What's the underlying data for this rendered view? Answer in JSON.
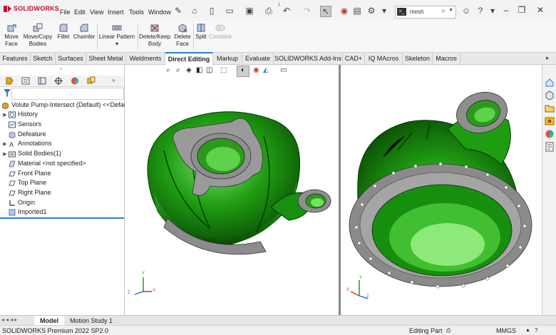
{
  "app": {
    "logo_text": "SOLIDWORKS",
    "menus": [
      "File",
      "Edit",
      "View",
      "Insert",
      "Tools",
      "Window"
    ],
    "search_value": "mesh",
    "brand_color": "#c8102e",
    "accent_color": "#2f7bd2",
    "model_color": "#1f9d12"
  },
  "commands": [
    {
      "label1": "Move",
      "label2": "Face",
      "icon": "move-face-icon",
      "enabled": true
    },
    {
      "label1": "Move/Copy",
      "label2": "Bodies",
      "icon": "move-copy-bodies-icon",
      "enabled": true
    },
    {
      "label1": "Fillet",
      "label2": "",
      "icon": "fillet-icon",
      "enabled": true
    },
    {
      "label1": "Chamfer",
      "label2": "",
      "icon": "chamfer-icon",
      "enabled": true
    },
    {
      "label1": "Linear Pattern",
      "label2": "",
      "icon": "linear-pattern-icon",
      "enabled": true
    },
    {
      "label1": "Delete/Keep",
      "label2": "Body",
      "icon": "delete-keep-body-icon",
      "enabled": true
    },
    {
      "label1": "Delete",
      "label2": "Face",
      "icon": "delete-face-icon",
      "enabled": true
    },
    {
      "label1": "Split",
      "label2": "",
      "icon": "split-icon",
      "enabled": true
    },
    {
      "label1": "Combine",
      "label2": "",
      "icon": "combine-icon",
      "enabled": false
    }
  ],
  "tabs": [
    "Features",
    "Sketch",
    "Surfaces",
    "Sheet Metal",
    "Weldments",
    "Direct Editing",
    "Markup",
    "Evaluate",
    "SOLIDWORKS Add-Ins",
    "CAD+",
    "IQ MAcros",
    "Skeleton",
    "Macros"
  ],
  "active_tab": "Direct Editing",
  "tree": {
    "root": "Volute Pump-Intersect (Default) <<Default",
    "items": [
      {
        "label": "History",
        "icon": "history-folder-icon",
        "expandable": true
      },
      {
        "label": "Sensors",
        "icon": "sensors-icon",
        "expandable": false
      },
      {
        "label": "Defeature",
        "icon": "defeature-icon",
        "expandable": false
      },
      {
        "label": "Annotations",
        "icon": "annotations-icon",
        "expandable": true
      },
      {
        "label": "Solid Bodies(1)",
        "icon": "solid-bodies-folder-icon",
        "expandable": true
      },
      {
        "label": "Material <not specified>",
        "icon": "material-icon",
        "expandable": false
      },
      {
        "label": "Front Plane",
        "icon": "plane-icon",
        "expandable": false
      },
      {
        "label": "Top Plane",
        "icon": "plane-icon",
        "expandable": false
      },
      {
        "label": "Right Plane",
        "icon": "plane-icon",
        "expandable": false
      },
      {
        "label": "Origin",
        "icon": "origin-icon",
        "expandable": false
      },
      {
        "label": "Imported1",
        "icon": "imported-body-icon",
        "expandable": false
      }
    ]
  },
  "triad": {
    "x": "X",
    "y": "Y",
    "z": "Z"
  },
  "bottom_tabs": [
    "Model",
    "Motion Study 1"
  ],
  "status": {
    "left": "SOLIDWORKS Premium 2022 SP2.0",
    "mode": "Editing Part",
    "units": "MMGS"
  }
}
